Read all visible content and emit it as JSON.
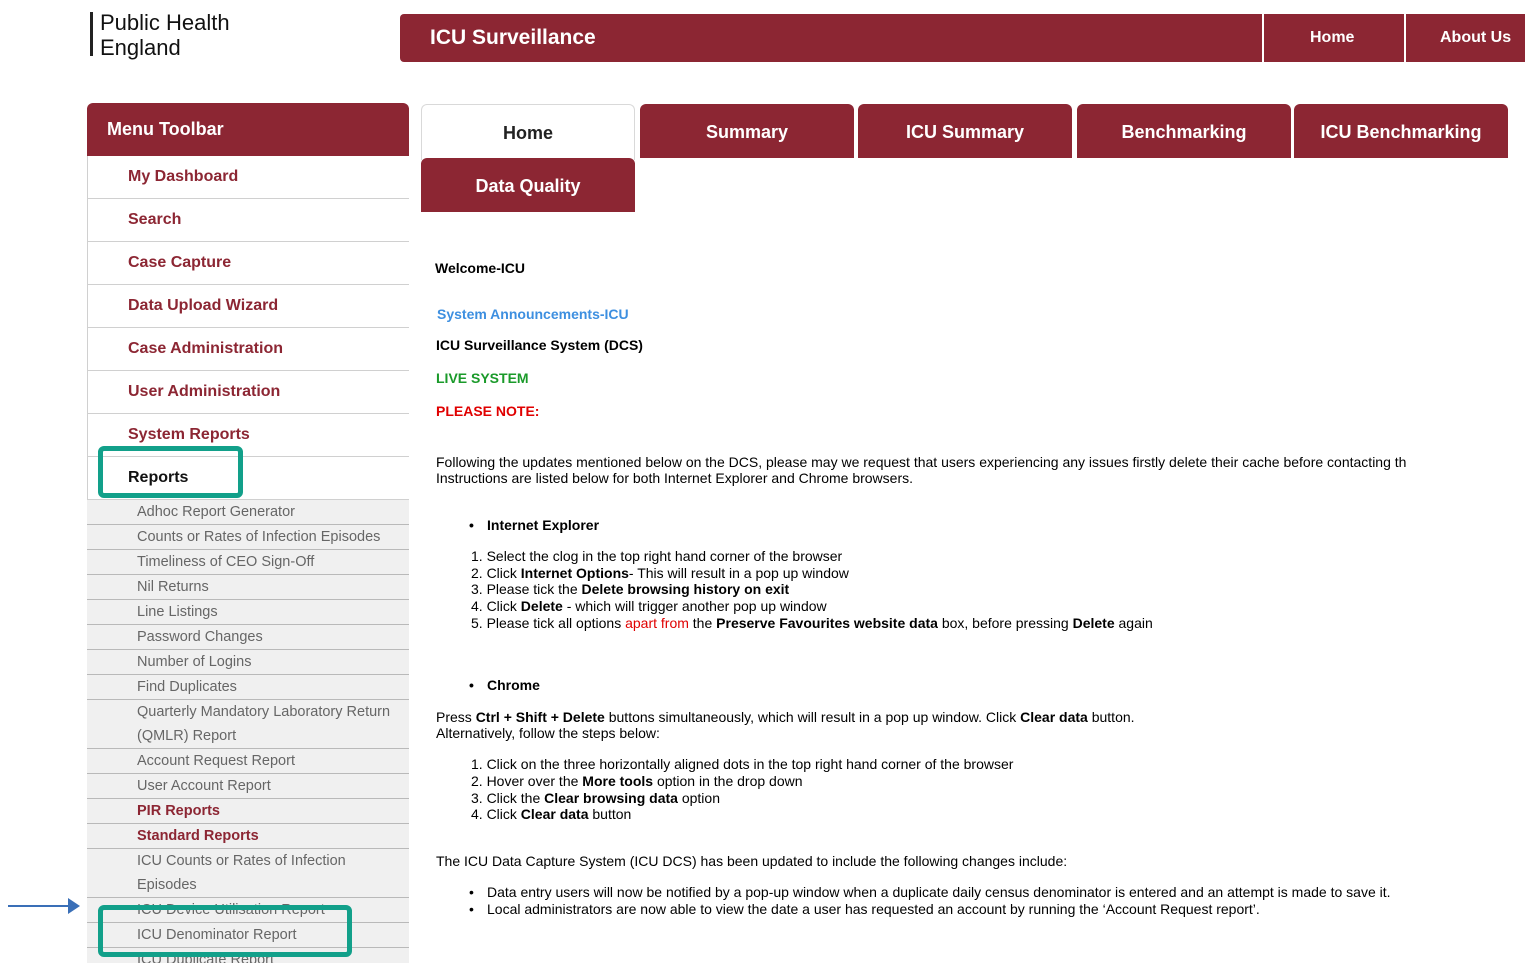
{
  "header": {
    "logo_line1": "Public Health",
    "logo_line2": "England",
    "app_title": "ICU Surveillance",
    "nav": [
      "Home",
      "About Us"
    ]
  },
  "sidebar": {
    "title": "Menu Toolbar",
    "items": [
      "My Dashboard",
      "Search",
      "Case Capture",
      "Data Upload Wizard",
      "Case Administration",
      "User Administration",
      "System Reports",
      "Reports"
    ],
    "sub_items": [
      "Adhoc Report Generator",
      "Counts or Rates of Infection Episodes",
      "Timeliness of CEO Sign-Off",
      "Nil Returns",
      "Line Listings",
      "Password Changes",
      "Number of Logins",
      "Find Duplicates",
      "Quarterly Mandatory Laboratory Return (QMLR) Report",
      "Account Request Report",
      "User Account Report",
      "PIR Reports",
      "Standard Reports",
      "ICU Counts or Rates of Infection Episodes",
      "ICU Device Utilisation Report",
      "ICU Denominator Report",
      "ICU Duplicate Report"
    ]
  },
  "tabs": [
    "Home",
    "Summary",
    "ICU Summary",
    "Benchmarking",
    "ICU Benchmarking",
    "Data Quality"
  ],
  "content": {
    "welcome": "Welcome-ICU",
    "announcements": "System Announcements-ICU",
    "system_name": "ICU Surveillance System (DCS)",
    "live": "LIVE SYSTEM",
    "note": "PLEASE NOTE:",
    "intro1": "Following the updates mentioned below on the DCS, please may we request that users experiencing any issues firstly delete their cache before contacting th",
    "intro2": "Instructions are listed below for both Internet Explorer and Chrome browsers.",
    "ie_heading": "Internet Explorer",
    "ie_1": "1. Select the clog in the top right hand corner of the browser",
    "ie_2a": "2. Click ",
    "ie_2b": "Internet Options",
    "ie_2c": "- This will result in a pop up window",
    "ie_3a": "3. Please tick the ",
    "ie_3b": "Delete browsing history on exit",
    "ie_4a": "4. Click ",
    "ie_4b": "Delete",
    "ie_4c": " - which will trigger another pop up window",
    "ie_5a": "5. Please tick all options ",
    "ie_5b": "apart from",
    "ie_5c": " the ",
    "ie_5d": "Preserve Favourites website data",
    "ie_5e": " box, before pressing ",
    "ie_5f": "Delete",
    "ie_5g": " again",
    "chrome_heading": "Chrome",
    "press_a": "Press ",
    "press_b": "Ctrl + Shift + Delete",
    "press_c": " buttons simultaneously, which will result in a pop up window. Click ",
    "press_d": "Clear data",
    "press_e": " button.",
    "alt": "Alternatively, follow the steps below:",
    "ch_1": "1. Click on the three horizontally aligned dots in the top right hand corner of the browser",
    "ch_2a": "2. Hover over the ",
    "ch_2b": "More tools",
    "ch_2c": " option in the drop down",
    "ch_3a": "3. Click the ",
    "ch_3b": "Clear browsing data",
    "ch_3c": " option",
    "ch_4a": "4. Click ",
    "ch_4b": "Clear data",
    "ch_4c": " button",
    "changes": "The ICU Data Capture System (ICU DCS) has been updated to include the following changes include:",
    "change_1": "Data entry users will now be notified by a pop-up window when a duplicate daily census denominator is entered and an attempt is made to save it.",
    "change_2": "Local administrators are now able to view the date a user has requested an account by running the ‘Account Request report’."
  },
  "colors": {
    "brand": "#8c2633",
    "highlight": "#12a08a",
    "arrow": "#3a6fb7",
    "link_blue": "#3d8fe0",
    "live_green": "#1a9a2a",
    "note_red": "#e00000"
  }
}
